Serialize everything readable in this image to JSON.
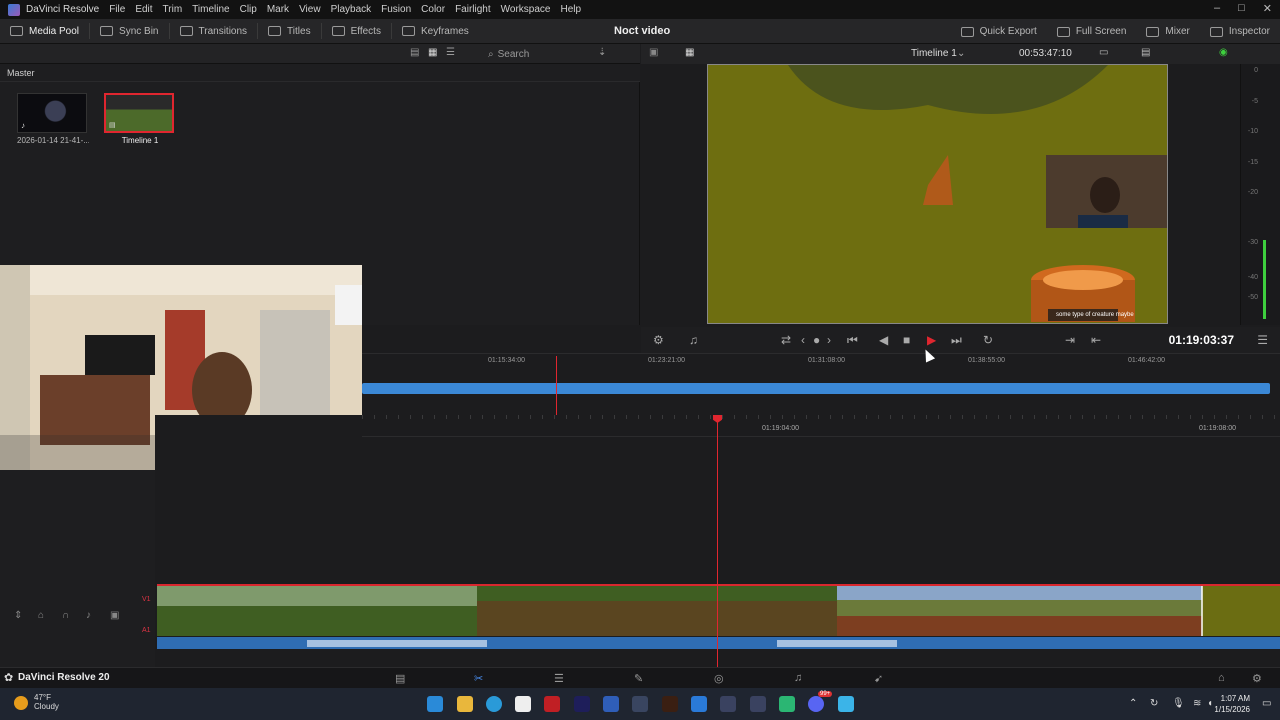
{
  "title_bar": {
    "app_name": "DaVinci Resolve",
    "menu": [
      "File",
      "Edit",
      "Trim",
      "Timeline",
      "Clip",
      "Mark",
      "View",
      "Playback",
      "Fusion",
      "Color",
      "Fairlight",
      "Workspace",
      "Help"
    ]
  },
  "toolbar": {
    "media_pool": "Media Pool",
    "sync_bin": "Sync Bin",
    "transitions": "Transitions",
    "titles": "Titles",
    "effects": "Effects",
    "keyframes": "Keyframes",
    "project_name": "Noct video",
    "quick_export": "Quick Export",
    "full_screen": "Full Screen",
    "mixer": "Mixer",
    "inspector": "Inspector"
  },
  "media_pool": {
    "search_placeholder": "Search",
    "bin": "Master",
    "clips": [
      {
        "label": "2026-01-14 21-41-..."
      },
      {
        "label": "Timeline 1"
      }
    ]
  },
  "viewer": {
    "timeline_name": "Timeline 1",
    "source_timecode": "00:53:47:10",
    "caption": "some type of creature maybe",
    "timecode": "01:19:03:37",
    "meter_scale": [
      "0",
      "-5",
      "-10",
      "-15",
      "-20",
      "-30",
      "-40",
      "-50"
    ],
    "meter_level": 0.32
  },
  "mini_timeline": {
    "ticks": [
      "01:15:34:00",
      "01:23:21:00",
      "01:31:08:00",
      "01:38:55:00",
      "01:46:42:00"
    ]
  },
  "timeline": {
    "ticks": [
      "01:19:04:00",
      "01:19:08:00"
    ],
    "video_track": "V1",
    "audio_track": "A1"
  },
  "page_bar": {
    "brand": "DaVinci Resolve 20"
  },
  "taskbar": {
    "temperature": "47°F",
    "condition": "Cloudy",
    "time": "1:07 AM",
    "date": "1/15/2026",
    "badge": "99+"
  },
  "colors": {
    "accent": "#e0262f",
    "track_blue": "#3b88d6",
    "active_page": "#4a8ef0"
  }
}
